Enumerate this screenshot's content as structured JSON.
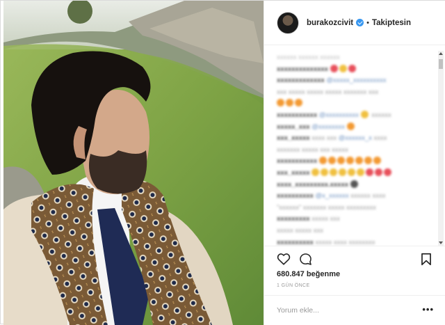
{
  "post": {
    "username": "burakozcivit",
    "verified": true,
    "separator": "•",
    "follow_label": "Takiptesin"
  },
  "stats": {
    "likes_text": "680.847 beğenme",
    "time_text": "1 GÜN ÖNCE"
  },
  "comment_box": {
    "placeholder": "Yorum ekle...",
    "more_label": "•••"
  },
  "icons": {
    "like": "heart-outline-icon",
    "comment": "speech-bubble-icon",
    "save": "bookmark-icon",
    "verified": "verified-badge-icon"
  },
  "colors": {
    "verified_blue": "#3897f0",
    "text_dark": "#262626",
    "text_muted": "#999999",
    "divider": "#efefef"
  }
}
